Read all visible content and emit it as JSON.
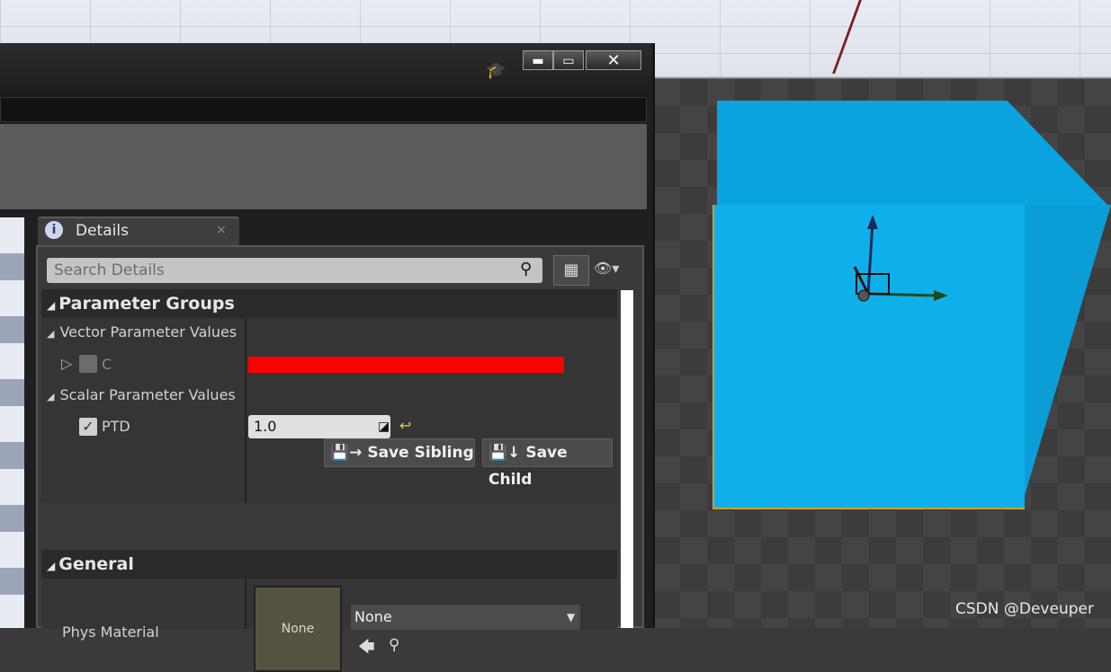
{
  "details_tab": {
    "label": "Details",
    "close": "×",
    "icon": "i"
  },
  "search": {
    "placeholder": "Search Details",
    "icon": "search-icon"
  },
  "toolbar": {
    "view_options_icon": "grid-icon",
    "visibility_icon": "eye-icon",
    "visibility_glyph": "👁▾"
  },
  "window_controls": {
    "minimize": "▬",
    "maximize": "▭",
    "close": "✕"
  },
  "sections": {
    "parameter_groups": "Parameter Groups",
    "general": "General"
  },
  "parameters": {
    "vector_header": "Vector Parameter Values",
    "vector_item_label": "C",
    "vector_item_color": "#ff0000",
    "scalar_header": "Scalar Parameter Values",
    "scalar_item_label": "PTD",
    "scalar_item_value": "1.0"
  },
  "buttons": {
    "save_sibling": "Save Sibling",
    "save_child": "Save Child"
  },
  "general": {
    "phys_material_label": "Phys Material",
    "thumbnail_text": "None",
    "combo_value": "None"
  },
  "watermark": "CSDN @Deveuper"
}
